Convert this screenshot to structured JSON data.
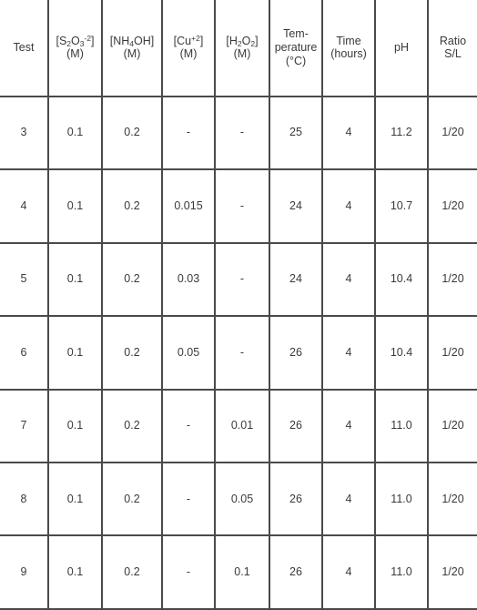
{
  "table": {
    "columns": [
      {
        "key": "test",
        "label": "Test",
        "sublabel": ""
      },
      {
        "key": "thiosulfate",
        "label": "[S2O3-2]",
        "sublabel": "(M)"
      },
      {
        "key": "ammonia",
        "label": "[NH4OH]",
        "sublabel": "(M)"
      },
      {
        "key": "copper",
        "label": "[Cu+2]",
        "sublabel": "(M)"
      },
      {
        "key": "peroxide",
        "label": "[H2O2]",
        "sublabel": "(M)"
      },
      {
        "key": "temperature",
        "label": "Tem-perature",
        "sublabel": "(°C)"
      },
      {
        "key": "time",
        "label": "Time",
        "sublabel": "(hours)"
      },
      {
        "key": "ph",
        "label": "pH",
        "sublabel": ""
      },
      {
        "key": "ratio",
        "label": "Ratio S/L",
        "sublabel": ""
      }
    ],
    "header_text": {
      "test": "Test",
      "thiosulfate_open": "[S",
      "thiosulfate_sub1": "2",
      "thiosulfate_o": "O",
      "thiosulfate_sub2": "3",
      "thiosulfate_sup": "-2",
      "thiosulfate_close": "]",
      "thiosulfate_unit": "(M)",
      "ammonia_open": "[NH",
      "ammonia_sub": "4",
      "ammonia_close": "OH]",
      "ammonia_unit": "(M)",
      "copper_open": "[Cu",
      "copper_sup": "+2",
      "copper_close": "]",
      "copper_unit": "(M)",
      "peroxide_open": "[H",
      "peroxide_sub1": "2",
      "peroxide_o": "O",
      "peroxide_sub2": "2",
      "peroxide_close": "]",
      "peroxide_unit": "(M)",
      "temperature_line1": "Tem-",
      "temperature_line2": "perature",
      "temperature_unit": "(°C)",
      "time_line1": "Time",
      "time_unit": "(hours)",
      "ph": "pH",
      "ratio_line1": "Ratio",
      "ratio_line2": "S/L"
    },
    "rows": [
      {
        "test": "3",
        "thiosulfate": "0.1",
        "ammonia": "0.2",
        "copper": "-",
        "peroxide": "-",
        "temperature": "25",
        "time": "4",
        "ph": "11.2",
        "ratio": "1/20"
      },
      {
        "test": "4",
        "thiosulfate": "0.1",
        "ammonia": "0.2",
        "copper": "0.015",
        "peroxide": "-",
        "temperature": "24",
        "time": "4",
        "ph": "10.7",
        "ratio": "1/20"
      },
      {
        "test": "5",
        "thiosulfate": "0.1",
        "ammonia": "0.2",
        "copper": "0.03",
        "peroxide": "-",
        "temperature": "24",
        "time": "4",
        "ph": "10.4",
        "ratio": "1/20"
      },
      {
        "test": "6",
        "thiosulfate": "0.1",
        "ammonia": "0.2",
        "copper": "0.05",
        "peroxide": "-",
        "temperature": "26",
        "time": "4",
        "ph": "10.4",
        "ratio": "1/20"
      },
      {
        "test": "7",
        "thiosulfate": "0.1",
        "ammonia": "0.2",
        "copper": "-",
        "peroxide": "0.01",
        "temperature": "26",
        "time": "4",
        "ph": "11.0",
        "ratio": "1/20"
      },
      {
        "test": "8",
        "thiosulfate": "0.1",
        "ammonia": "0.2",
        "copper": "-",
        "peroxide": "0.05",
        "temperature": "26",
        "time": "4",
        "ph": "11.0",
        "ratio": "1/20"
      },
      {
        "test": "9",
        "thiosulfate": "0.1",
        "ammonia": "0.2",
        "copper": "-",
        "peroxide": "0.1",
        "temperature": "26",
        "time": "4",
        "ph": "11.0",
        "ratio": "1/20"
      }
    ]
  },
  "style": {
    "line_color": "#4a4a4a",
    "text_color": "#3a3a3a",
    "background": "#ffffff"
  }
}
